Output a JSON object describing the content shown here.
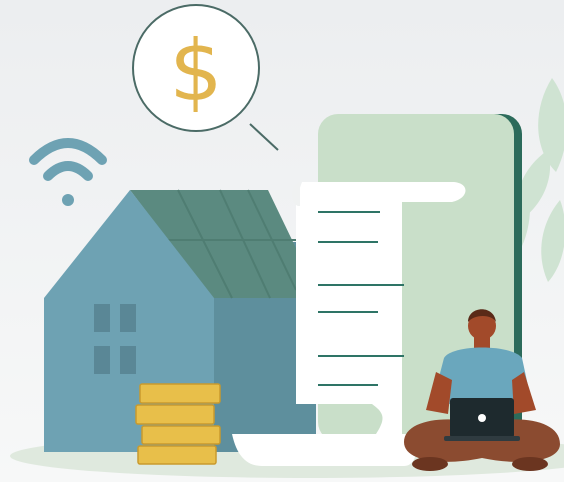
{
  "illustration": {
    "dollar_symbol": "$",
    "icons": [
      "wifi-icon",
      "dollar-bubble-icon",
      "laptop-icon"
    ],
    "colors": {
      "background": "#eef0f1",
      "house_front": "#6ea2b3",
      "house_side": "#5e8f9d",
      "roof_solar": "#5b8a80",
      "phone_body": "#c9dfc9",
      "phone_edge": "#2c6b5b",
      "receipt": "#ffffff",
      "receipt_lines": "#2e7466",
      "coins": "#e8bf4a",
      "person_shirt": "#6aa7bd",
      "person_pants": "#8b4b30",
      "person_skin": "#a24a2a",
      "ground": "#dde8dc",
      "leaves": "#cfe3d2",
      "dollar": "#e2b54e"
    }
  }
}
